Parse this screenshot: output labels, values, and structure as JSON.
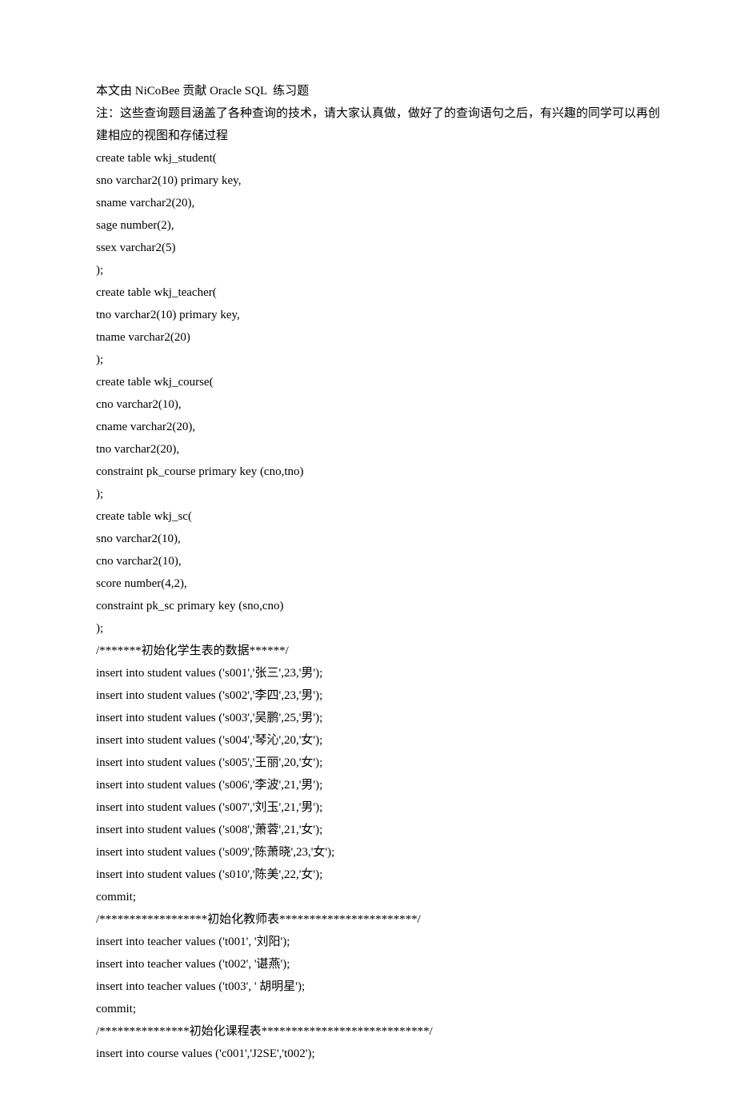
{
  "lines": [
    "本文由 NiCoBee 贡献 Oracle SQL  练习题",
    "注：这些查询题目涵盖了各种查询的技术，请大家认真做，做好了的查询语句之后，有兴趣的同学可以再创建相应的视图和存储过程",
    "create table wkj_student(",
    "sno varchar2(10) primary key,",
    "sname varchar2(20),",
    "sage number(2),",
    "ssex varchar2(5)",
    ");",
    "create table wkj_teacher(",
    "tno varchar2(10) primary key,",
    "tname varchar2(20)",
    ");",
    "create table wkj_course(",
    "cno varchar2(10),",
    "cname varchar2(20),",
    "tno varchar2(20),",
    "constraint pk_course primary key (cno,tno)",
    ");",
    "create table wkj_sc(",
    "sno varchar2(10),",
    "cno varchar2(10),",
    "score number(4,2),",
    "constraint pk_sc primary key (sno,cno)",
    ");",
    "/*******初始化学生表的数据******/",
    "insert into student values ('s001','张三',23,'男');",
    "insert into student values ('s002','李四',23,'男');",
    "insert into student values ('s003','吴鹏',25,'男');",
    "insert into student values ('s004','琴沁',20,'女');",
    "insert into student values ('s005','王丽',20,'女');",
    "insert into student values ('s006','李波',21,'男');",
    "insert into student values ('s007','刘玉',21,'男');",
    "insert into student values ('s008','萧蓉',21,'女');",
    "insert into student values ('s009','陈萧晓',23,'女');",
    "insert into student values ('s010','陈美',22,'女');",
    "commit;",
    "/******************初始化教师表***********************/",
    "insert into teacher values ('t001', '刘阳');",
    "insert into teacher values ('t002', '谌燕');",
    "insert into teacher values ('t003', ' 胡明星');",
    "commit;",
    "/***************初始化课程表****************************/",
    "insert into course values ('c001','J2SE','t002');"
  ]
}
